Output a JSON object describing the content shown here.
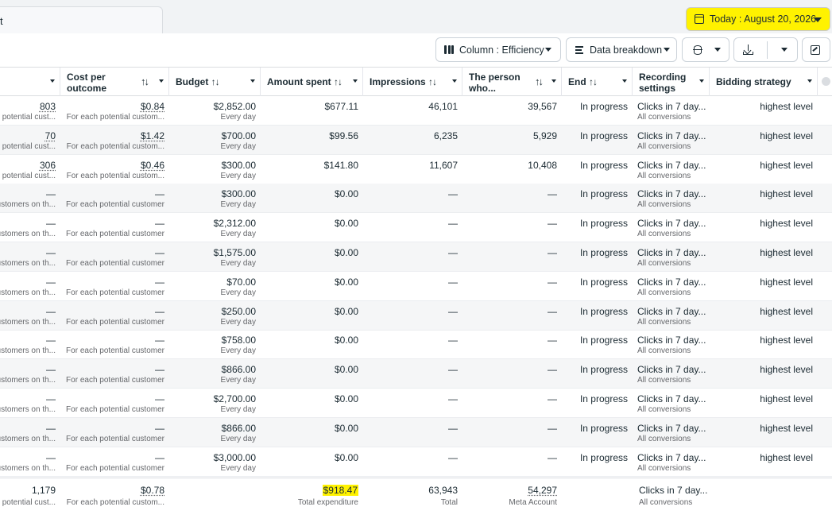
{
  "header": {
    "tab_title_fragment": "t",
    "date_label": "Today : August 20, 2026"
  },
  "toolbar": {
    "columns_label": "Column : Efficiency",
    "breakdown_label": "Data breakdown"
  },
  "columns": {
    "results": "",
    "cost_per_outcome": "Cost per outcome",
    "budget": "Budget",
    "amount_spent": "Amount spent",
    "impressions": "Impressions",
    "reach": "The person who...",
    "end": "End",
    "recording_settings": "Recording settings",
    "bidding_strategy": "Bidding strategy"
  },
  "sort_glyph": "↑↓",
  "rows": [
    {
      "results": "803",
      "results_sub": "potential cust...",
      "cost": "$0.84",
      "cost_sub": "For each potential custom...",
      "budget": "$2,852.00",
      "budget_sub": "Every day",
      "spent": "$677.11",
      "impressions": "46,101",
      "reach": "39,567",
      "end": "In progress",
      "rec": "Clicks in 7 day...",
      "rec_sub": "All conversions",
      "bid": "highest level"
    },
    {
      "results": "70",
      "results_sub": "potential cust...",
      "cost": "$1.42",
      "cost_sub": "For each potential custom...",
      "budget": "$700.00",
      "budget_sub": "Every day",
      "spent": "$99.56",
      "impressions": "6,235",
      "reach": "5,929",
      "end": "In progress",
      "rec": "Clicks in 7 day...",
      "rec_sub": "All conversions",
      "bid": "highest level"
    },
    {
      "results": "306",
      "results_sub": "potential cust...",
      "cost": "$0.46",
      "cost_sub": "For each potential custom...",
      "budget": "$300.00",
      "budget_sub": "Every day",
      "spent": "$141.80",
      "impressions": "11,607",
      "reach": "10,408",
      "end": "In progress",
      "rec": "Clicks in 7 day...",
      "rec_sub": "All conversions",
      "bid": "highest level"
    },
    {
      "results": "—",
      "results_sub": "ustomers on th...",
      "cost": "—",
      "cost_sub": "For each potential customer",
      "budget": "$300.00",
      "budget_sub": "Every day",
      "spent": "$0.00",
      "impressions": "—",
      "reach": "—",
      "end": "In progress",
      "rec": "Clicks in 7 day...",
      "rec_sub": "All conversions",
      "bid": "highest level"
    },
    {
      "results": "—",
      "results_sub": "ustomers on th...",
      "cost": "—",
      "cost_sub": "For each potential customer",
      "budget": "$2,312.00",
      "budget_sub": "Every day",
      "spent": "$0.00",
      "impressions": "—",
      "reach": "—",
      "end": "In progress",
      "rec": "Clicks in 7 day...",
      "rec_sub": "All conversions",
      "bid": "highest level"
    },
    {
      "results": "—",
      "results_sub": "ustomers on th...",
      "cost": "—",
      "cost_sub": "For each potential customer",
      "budget": "$1,575.00",
      "budget_sub": "Every day",
      "spent": "$0.00",
      "impressions": "—",
      "reach": "—",
      "end": "In progress",
      "rec": "Clicks in 7 day...",
      "rec_sub": "All conversions",
      "bid": "highest level"
    },
    {
      "results": "—",
      "results_sub": "ustomers on th...",
      "cost": "—",
      "cost_sub": "For each potential customer",
      "budget": "$70.00",
      "budget_sub": "Every day",
      "spent": "$0.00",
      "impressions": "—",
      "reach": "—",
      "end": "In progress",
      "rec": "Clicks in 7 day...",
      "rec_sub": "All conversions",
      "bid": "highest level"
    },
    {
      "results": "—",
      "results_sub": "ustomers on th...",
      "cost": "—",
      "cost_sub": "For each potential customer",
      "budget": "$250.00",
      "budget_sub": "Every day",
      "spent": "$0.00",
      "impressions": "—",
      "reach": "—",
      "end": "In progress",
      "rec": "Clicks in 7 day...",
      "rec_sub": "All conversions",
      "bid": "highest level"
    },
    {
      "results": "—",
      "results_sub": "ustomers on th...",
      "cost": "—",
      "cost_sub": "For each potential customer",
      "budget": "$758.00",
      "budget_sub": "Every day",
      "spent": "$0.00",
      "impressions": "—",
      "reach": "—",
      "end": "In progress",
      "rec": "Clicks in 7 day...",
      "rec_sub": "All conversions",
      "bid": "highest level"
    },
    {
      "results": "—",
      "results_sub": "ustomers on th...",
      "cost": "—",
      "cost_sub": "For each potential customer",
      "budget": "$866.00",
      "budget_sub": "Every day",
      "spent": "$0.00",
      "impressions": "—",
      "reach": "—",
      "end": "In progress",
      "rec": "Clicks in 7 day...",
      "rec_sub": "All conversions",
      "bid": "highest level"
    },
    {
      "results": "—",
      "results_sub": "ustomers on th...",
      "cost": "—",
      "cost_sub": "For each potential customer",
      "budget": "$2,700.00",
      "budget_sub": "Every day",
      "spent": "$0.00",
      "impressions": "—",
      "reach": "—",
      "end": "In progress",
      "rec": "Clicks in 7 day...",
      "rec_sub": "All conversions",
      "bid": "highest level"
    },
    {
      "results": "—",
      "results_sub": "ustomers on th...",
      "cost": "—",
      "cost_sub": "For each potential customer",
      "budget": "$866.00",
      "budget_sub": "Every day",
      "spent": "$0.00",
      "impressions": "—",
      "reach": "—",
      "end": "In progress",
      "rec": "Clicks in 7 day...",
      "rec_sub": "All conversions",
      "bid": "highest level"
    },
    {
      "results": "—",
      "results_sub": "ustomers on th...",
      "cost": "—",
      "cost_sub": "For each potential customer",
      "budget": "$3,000.00",
      "budget_sub": "Every day",
      "spent": "$0.00",
      "impressions": "—",
      "reach": "—",
      "end": "In progress",
      "rec": "Clicks in 7 day...",
      "rec_sub": "All conversions",
      "bid": "highest level"
    }
  ],
  "summary": {
    "results": "1,179",
    "results_sub": "potential cust...",
    "cost": "$0.78",
    "cost_sub": "For each potential custom...",
    "spent": "$918.47",
    "spent_sub": "Total expenditure",
    "impressions": "63,943",
    "impressions_sub": "Total",
    "reach": "54,297",
    "reach_sub": "Meta Account",
    "rec": "Clicks in 7 day...",
    "rec_sub": "All conversions"
  },
  "colors": {
    "highlight": "#fff200",
    "text": "#1c2b33",
    "muted": "#65676b"
  }
}
